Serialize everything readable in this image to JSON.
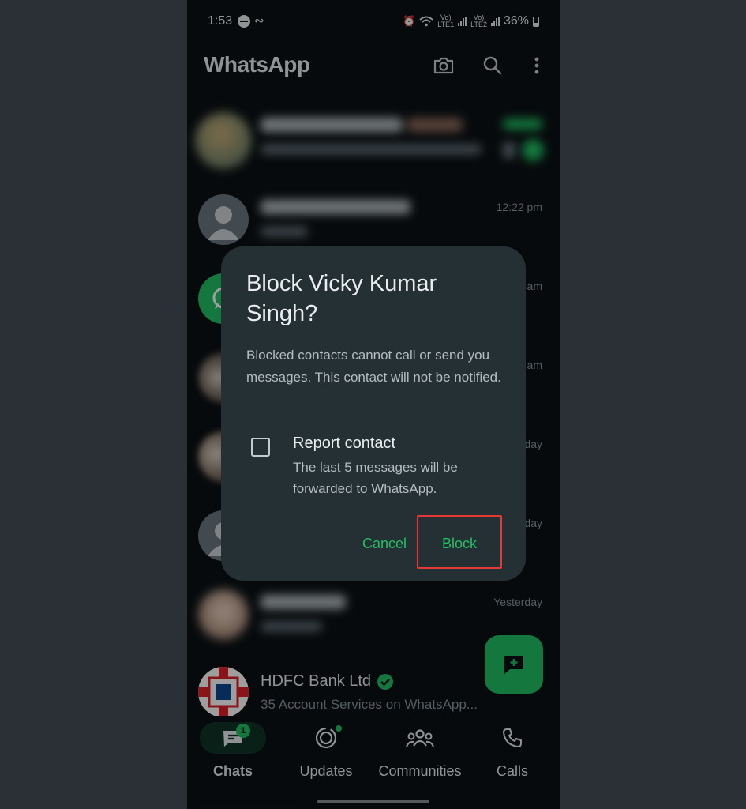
{
  "status_bar": {
    "time": "1:53",
    "sim1": "LTE1",
    "sim2": "LTE2",
    "battery": "36%"
  },
  "app_bar": {
    "title": "WhatsApp",
    "icons": [
      "camera-icon",
      "search-icon",
      "more-vert-icon"
    ]
  },
  "chats": [
    {
      "name": "",
      "preview": "",
      "time": "",
      "blurred": true
    },
    {
      "name": "",
      "preview": "",
      "time": "12:22 pm",
      "blurred": true
    },
    {
      "name": "",
      "preview": "",
      "time": "am",
      "blurred": true
    },
    {
      "name": "",
      "preview": "",
      "time": "am",
      "blurred": true
    },
    {
      "name": "",
      "preview": "",
      "time": "day",
      "blurred": true
    },
    {
      "name": "",
      "preview": "",
      "time": "day",
      "blurred": true
    },
    {
      "name": "",
      "preview": "",
      "time": "Yesterday",
      "blurred": true
    },
    {
      "name": "HDFC Bank Ltd",
      "preview": "35 Account Services on WhatsApp...",
      "time": "",
      "verified": true
    }
  ],
  "dialog": {
    "title": "Block Vicky Kumar Singh?",
    "body": "Blocked contacts cannot call or send you messages. This contact will not be notified.",
    "checkbox_title": "Report contact",
    "checkbox_subtitle": "The last 5 messages will be forwarded to WhatsApp.",
    "checkbox_checked": false,
    "cancel_label": "Cancel",
    "block_label": "Block"
  },
  "bottom_nav": {
    "tabs": [
      {
        "label": "Chats",
        "badge": "1",
        "active": true
      },
      {
        "label": "Updates",
        "active": false
      },
      {
        "label": "Communities",
        "active": false
      },
      {
        "label": "Calls",
        "active": false
      }
    ]
  },
  "colors": {
    "accent": "#21c063",
    "background": "#0c1115",
    "dialog": "#253034",
    "highlight": "#e53935"
  }
}
